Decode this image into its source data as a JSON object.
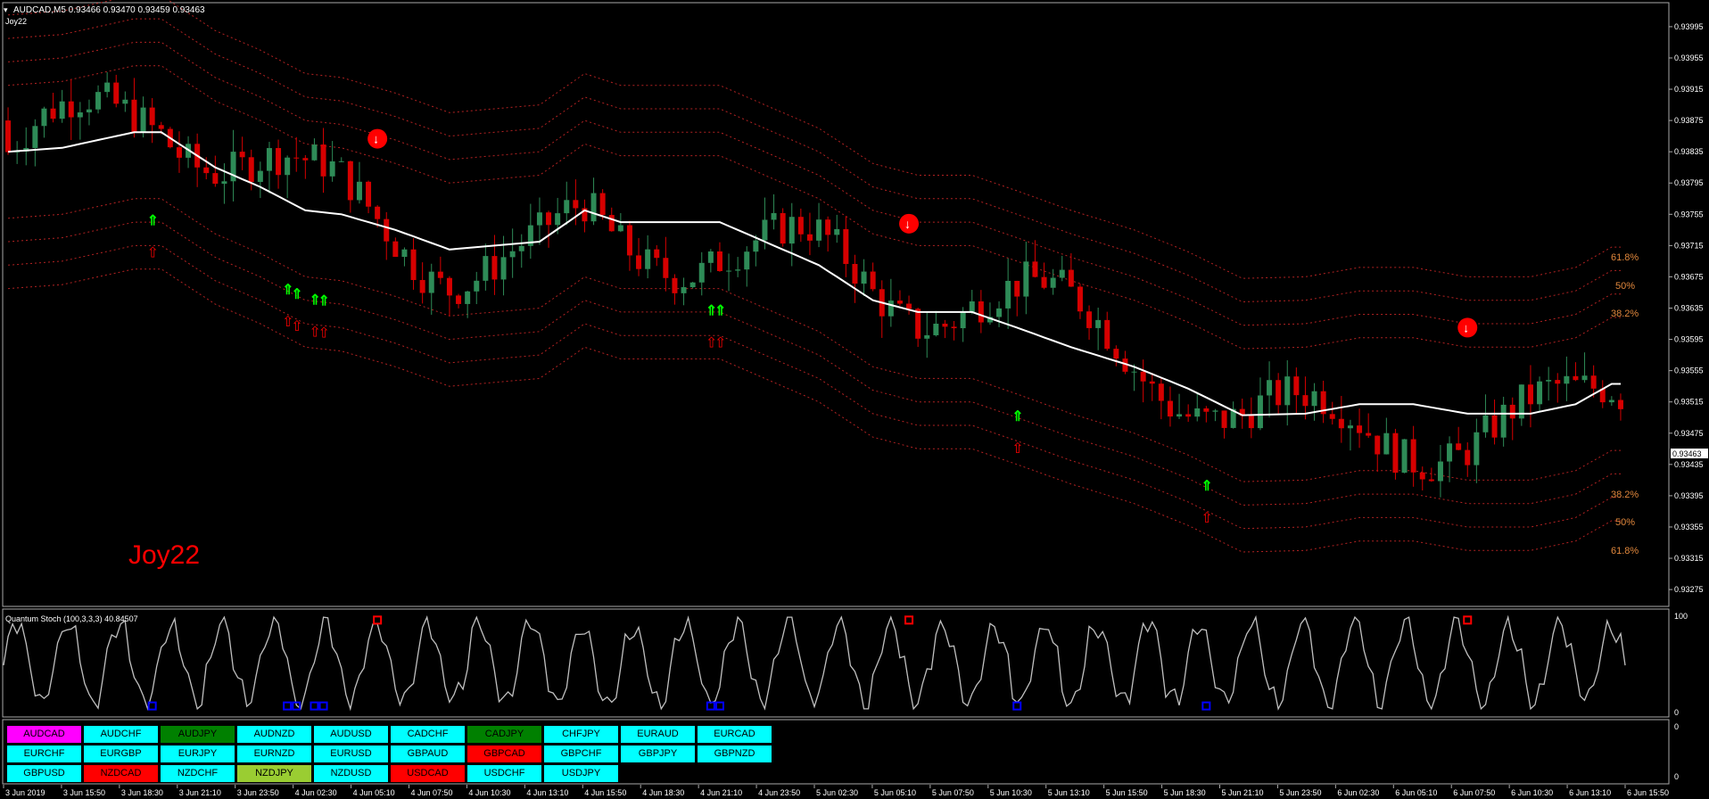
{
  "header": {
    "symbol_line": "AUDCAD,M5  0.93466 0.93470 0.93459 0.93463",
    "indicator": "Joy22"
  },
  "watermark": "Joy22",
  "price_label_current": "0.93463",
  "fib_labels": {
    "upper": [
      "61.8%",
      "50%",
      "38.2%"
    ],
    "lower": [
      "38.2%",
      "50%",
      "61.8%"
    ]
  },
  "stoch": {
    "title": "Quantum Stoch (100,3,3,3) 40.84507",
    "scale_top": "100",
    "scale_bottom": "0"
  },
  "buttons_scale": {
    "top": "0",
    "bottom": "0"
  },
  "colors": {
    "bg": "#000000",
    "frame": "#a9a9a9",
    "bull": "#2e8b57",
    "bear": "#d60000",
    "ma": "#ffffff",
    "band": "#b22222",
    "fib_text": "#e0873c",
    "buy_arrow": "#00ff00",
    "sell_arrow": "#ff0000",
    "stoch_line": "#c0c0c0"
  },
  "currency_buttons": [
    [
      {
        "label": "AUDCAD",
        "color": "#ff00ff"
      },
      {
        "label": "AUDCHF",
        "color": "#00ffff"
      },
      {
        "label": "AUDJPY",
        "color": "#008000"
      },
      {
        "label": "AUDNZD",
        "color": "#00ffff"
      },
      {
        "label": "AUDUSD",
        "color": "#00ffff"
      },
      {
        "label": "CADCHF",
        "color": "#00ffff"
      },
      {
        "label": "CADJPY",
        "color": "#008000"
      },
      {
        "label": "CHFJPY",
        "color": "#00ffff"
      },
      {
        "label": "EURAUD",
        "color": "#00ffff"
      },
      {
        "label": "EURCAD",
        "color": "#00ffff"
      }
    ],
    [
      {
        "label": "EURCHF",
        "color": "#00ffff"
      },
      {
        "label": "EURGBP",
        "color": "#00ffff"
      },
      {
        "label": "EURJPY",
        "color": "#00ffff"
      },
      {
        "label": "EURNZD",
        "color": "#00ffff"
      },
      {
        "label": "EURUSD",
        "color": "#00ffff"
      },
      {
        "label": "GBPAUD",
        "color": "#00ffff"
      },
      {
        "label": "GBPCAD",
        "color": "#ff0000"
      },
      {
        "label": "GBPCHF",
        "color": "#00ffff"
      },
      {
        "label": "GBPJPY",
        "color": "#00ffff"
      },
      {
        "label": "GBPNZD",
        "color": "#00ffff"
      }
    ],
    [
      {
        "label": "GBPUSD",
        "color": "#00ffff"
      },
      {
        "label": "NZDCAD",
        "color": "#ff0000"
      },
      {
        "label": "NZDCHF",
        "color": "#00ffff"
      },
      {
        "label": "NZDJPY",
        "color": "#9acd32"
      },
      {
        "label": "NZDUSD",
        "color": "#00ffff"
      },
      {
        "label": "USDCAD",
        "color": "#ff0000"
      },
      {
        "label": "USDCHF",
        "color": "#00ffff"
      },
      {
        "label": "USDJPY",
        "color": "#00ffff"
      }
    ]
  ],
  "chart_data": {
    "type": "candlestick",
    "symbol": "AUDCAD",
    "timeframe": "M5",
    "y_ticks": [
      "0.93995",
      "0.93955",
      "0.93915",
      "0.93875",
      "0.93835",
      "0.93795",
      "0.93755",
      "0.93715",
      "0.93675",
      "0.93635",
      "0.93595",
      "0.93555",
      "0.93515",
      "0.93475",
      "0.93435",
      "0.93395",
      "0.93355",
      "0.93315",
      "0.93275"
    ],
    "ylim": [
      0.93258,
      0.9402
    ],
    "x_ticks": [
      "3 Jun 2019",
      "3 Jun 15:50",
      "3 Jun 18:30",
      "3 Jun 21:10",
      "3 Jun 23:50",
      "4 Jun 02:30",
      "4 Jun 05:10",
      "4 Jun 07:50",
      "4 Jun 10:30",
      "4 Jun 13:10",
      "4 Jun 15:50",
      "4 Jun 18:30",
      "4 Jun 21:10",
      "4 Jun 23:50",
      "5 Jun 02:30",
      "5 Jun 05:10",
      "5 Jun 07:50",
      "5 Jun 10:30",
      "5 Jun 13:10",
      "5 Jun 15:50",
      "5 Jun 18:30",
      "5 Jun 21:10",
      "5 Jun 23:50",
      "6 Jun 02:30",
      "6 Jun 05:10",
      "6 Jun 07:50",
      "6 Jun 10:30",
      "6 Jun 13:10",
      "6 Jun 15:50"
    ],
    "ma_path": [
      [
        0,
        0.93835
      ],
      [
        6,
        0.9384
      ],
      [
        10,
        0.9385
      ],
      [
        14,
        0.9386
      ],
      [
        17,
        0.9386
      ],
      [
        23,
        0.93815
      ],
      [
        28,
        0.9379
      ],
      [
        33,
        0.9376
      ],
      [
        37,
        0.93755
      ],
      [
        43,
        0.93735
      ],
      [
        49,
        0.9371
      ],
      [
        54,
        0.93715
      ],
      [
        59,
        0.9372
      ],
      [
        64,
        0.9376
      ],
      [
        68,
        0.93745
      ],
      [
        73,
        0.93745
      ],
      [
        79,
        0.93745
      ],
      [
        84,
        0.9372
      ],
      [
        90,
        0.9369
      ],
      [
        96,
        0.93645
      ],
      [
        101,
        0.9363
      ],
      [
        107,
        0.9363
      ],
      [
        112,
        0.9361
      ],
      [
        118,
        0.93585
      ],
      [
        125,
        0.9356
      ],
      [
        131,
        0.93532
      ],
      [
        137,
        0.93498
      ],
      [
        144,
        0.935
      ],
      [
        150,
        0.93512
      ],
      [
        156,
        0.93512
      ],
      [
        162,
        0.935
      ],
      [
        169,
        0.935
      ],
      [
        174,
        0.93512
      ],
      [
        178,
        0.93538
      ]
    ],
    "band_offsets": [
      0.00175,
      0.00145,
      0.00115,
      0.00085,
      -0.00085,
      -0.00115,
      -0.00145,
      -0.00175
    ],
    "last_price": 0.93463,
    "buy_signals": [
      16,
      31,
      32,
      34,
      35,
      78,
      79,
      112,
      133
    ],
    "sell_signals": [
      41,
      100,
      162
    ],
    "stoch_range": [
      0,
      100
    ]
  }
}
